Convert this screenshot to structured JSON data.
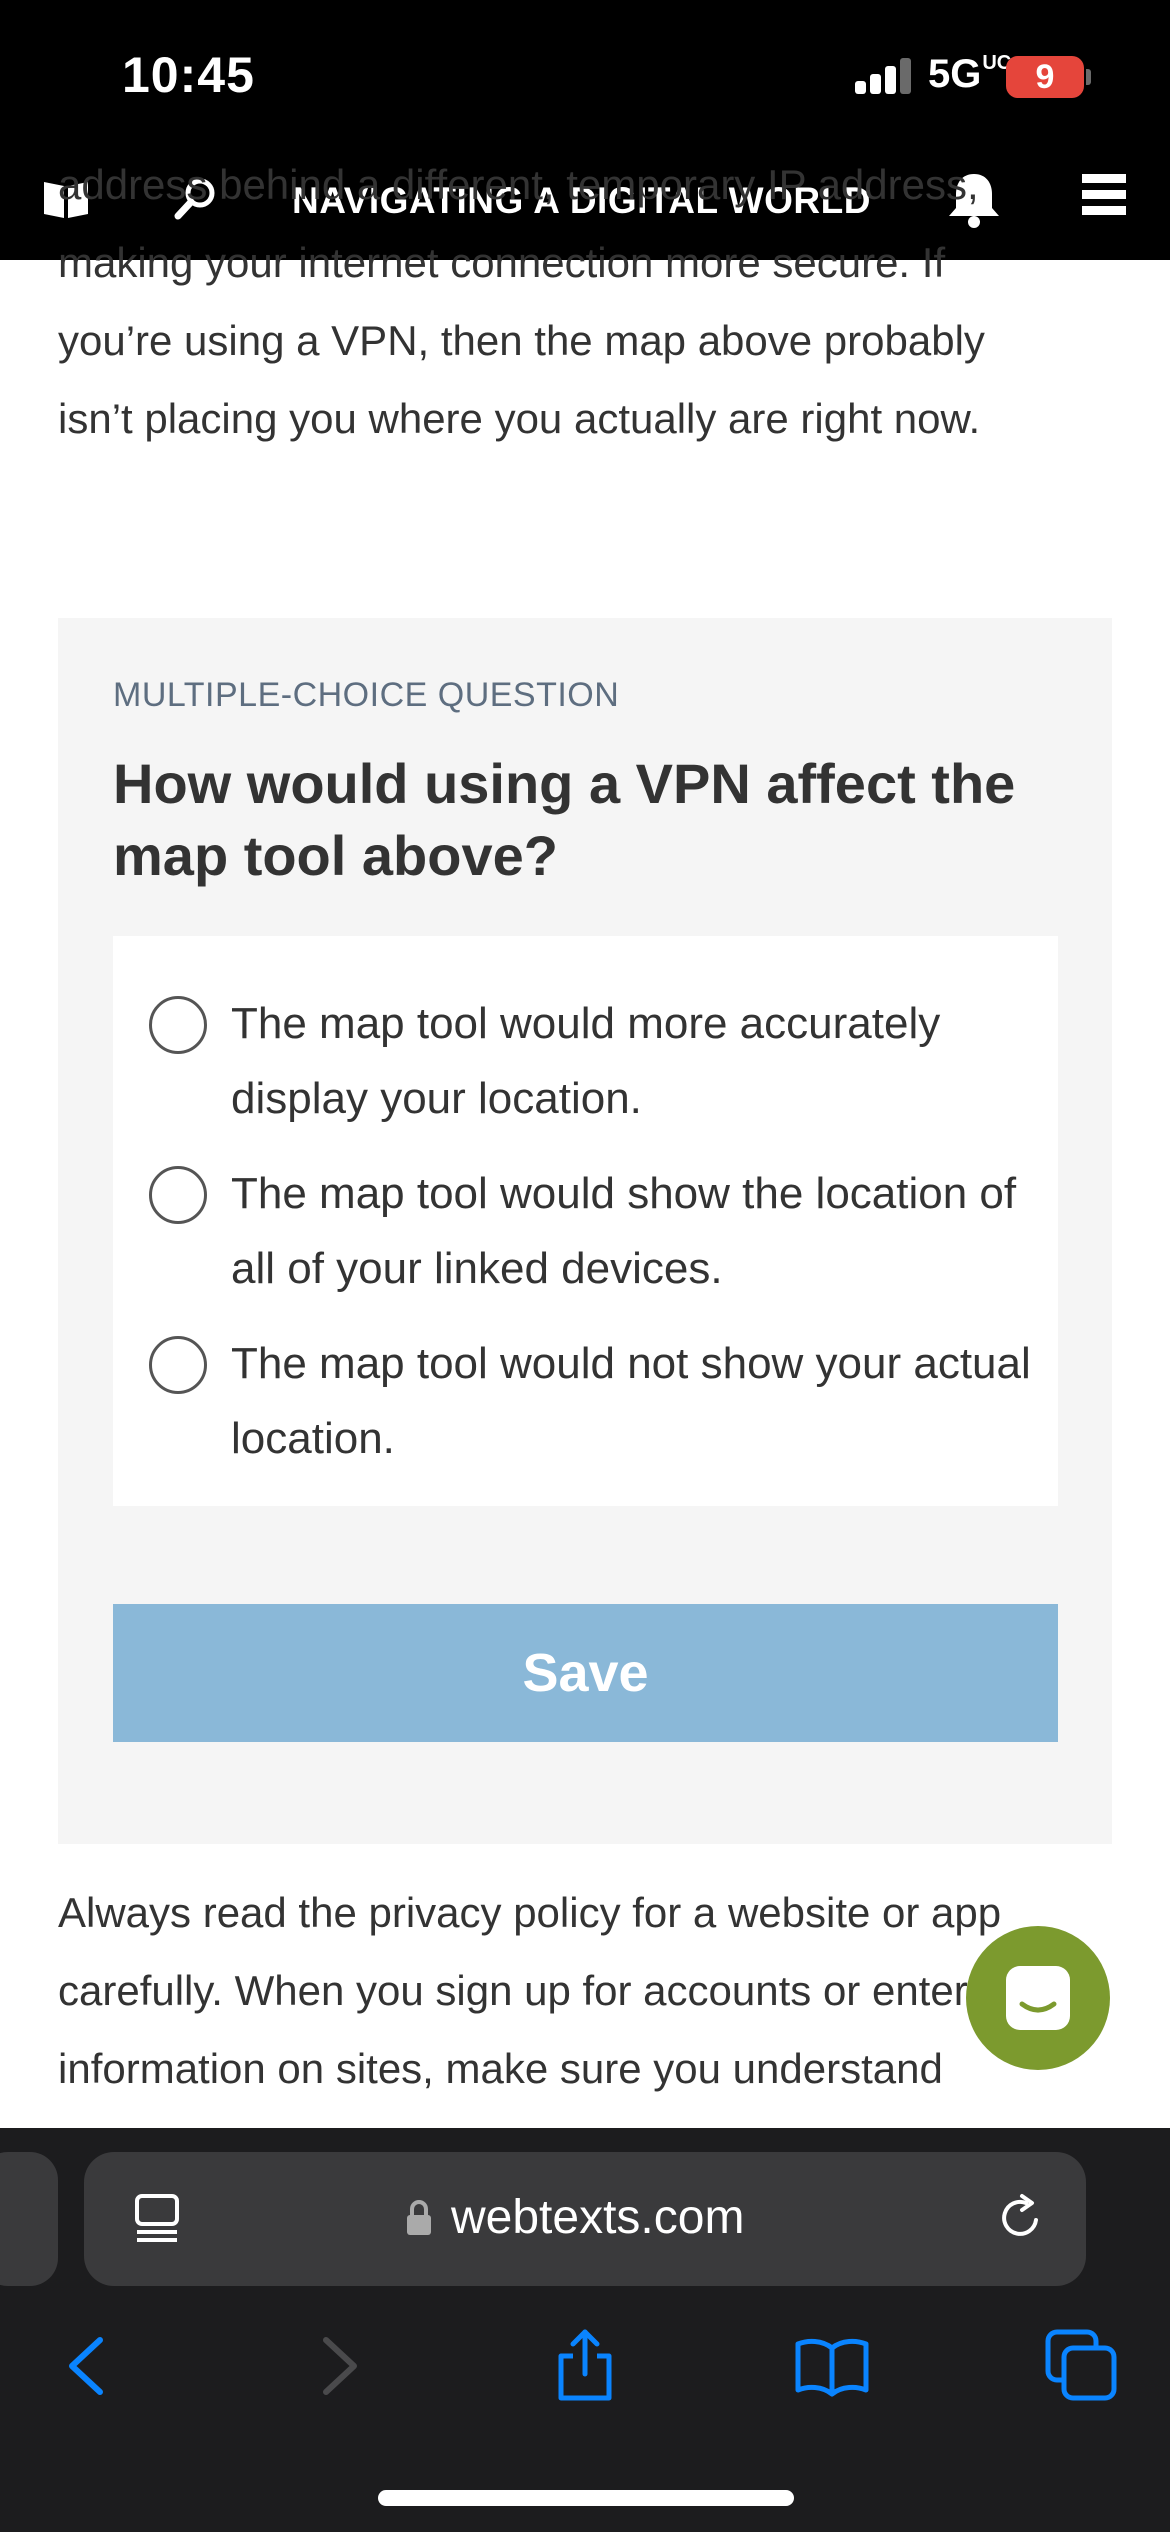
{
  "status_bar": {
    "time": "10:45",
    "network": "5G",
    "network_suffix": "UC",
    "battery": "9"
  },
  "nav": {
    "title": "NAVIGATING A DIGITAL WORLD",
    "icons": [
      "book-icon",
      "search-icon",
      "bell-icon",
      "menu-icon"
    ]
  },
  "article": {
    "top_partial_line": "address behind a different, temporary IP address,",
    "top_lines": [
      "making your internet connection more secure. If",
      "you’re using a VPN, then the map above probably",
      "isn’t placing you where you actually are right now."
    ],
    "bottom_lines": [
      "Always read the privacy policy for a website or app",
      "carefully. When you sign up for accounts or enter",
      "information on sites, make sure you understand"
    ]
  },
  "question": {
    "type_label": "MULTIPLE-CHOICE QUESTION",
    "prompt": "How would using a VPN affect the map tool above?",
    "options": [
      {
        "label": "The map tool would more accurately display your location.",
        "selected": false
      },
      {
        "label": "The map tool would show the location of all of your linked devices.",
        "selected": false
      },
      {
        "label": "The map tool would not show your actual location.",
        "selected": false
      }
    ],
    "save_label": "Save"
  },
  "browser": {
    "url": "webtexts.com",
    "toolbar_icons": [
      "back-icon",
      "forward-icon",
      "share-icon",
      "bookmarks-icon",
      "tabs-icon"
    ]
  },
  "colors": {
    "brand_black": "#000000",
    "save_button": "#8ab8d8",
    "chat_bubble": "#7c9a2e",
    "ios_blue": "#0a84ff"
  }
}
